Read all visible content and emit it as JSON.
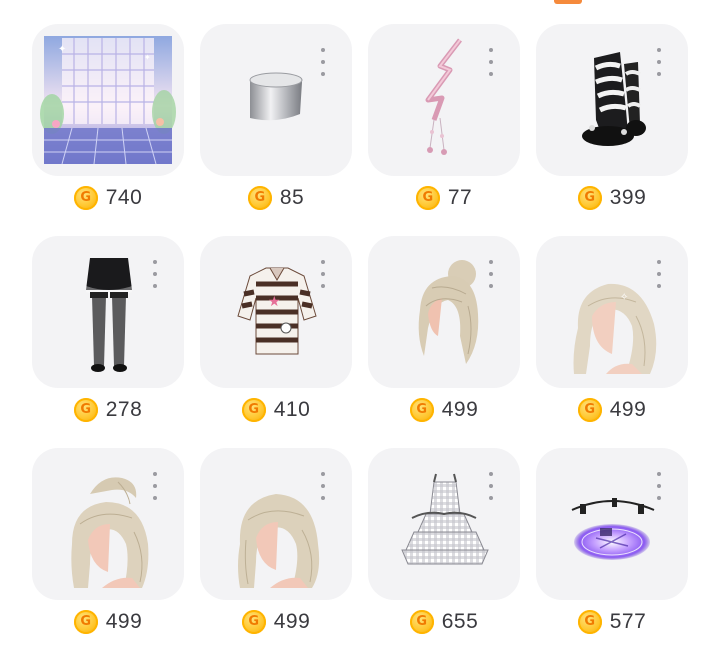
{
  "colors": {
    "accent_orange": "#f58a3c",
    "coin_gold": "#ffc62e",
    "card_bg": "#f3f3f5"
  },
  "items": [
    {
      "thumb": "window-backdrop",
      "price": "740"
    },
    {
      "thumb": "silver-armband",
      "price": "85"
    },
    {
      "thumb": "pink-hair-clip",
      "price": "77"
    },
    {
      "thumb": "zebra-boots",
      "price": "399"
    },
    {
      "thumb": "black-skirt-stockings",
      "price": "278"
    },
    {
      "thumb": "striped-sweater",
      "price": "410"
    },
    {
      "thumb": "blonde-bun-hair",
      "price": "499"
    },
    {
      "thumb": "blonde-side-hair",
      "price": "499"
    },
    {
      "thumb": "blonde-updo-hair",
      "price": "499"
    },
    {
      "thumb": "blonde-long-hair",
      "price": "499"
    },
    {
      "thumb": "gingham-dress",
      "price": "655"
    },
    {
      "thumb": "purple-magic-circle",
      "price": "577"
    }
  ]
}
